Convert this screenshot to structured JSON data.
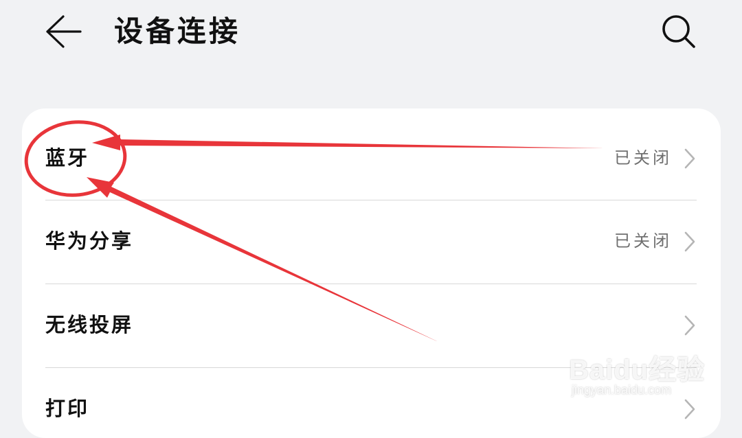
{
  "header": {
    "title": "设备连接",
    "back_icon": "arrow-left-icon",
    "search_icon": "search-icon"
  },
  "settings": {
    "items": [
      {
        "label": "蓝牙",
        "status": "已关闭",
        "icon": "chevron-right-icon"
      },
      {
        "label": "华为分享",
        "status": "已关闭",
        "icon": "chevron-right-icon"
      },
      {
        "label": "无线投屏",
        "status": "",
        "icon": "chevron-right-icon"
      },
      {
        "label": "打印",
        "status": "",
        "icon": "chevron-right-icon"
      }
    ]
  },
  "watermark": {
    "brand": "Baidu经验",
    "url": "jingyan.baidu.com"
  },
  "colors": {
    "background": "#f1f2f4",
    "card": "#ffffff",
    "annotation": "#e8353a",
    "status_text": "#6f6f6f"
  }
}
